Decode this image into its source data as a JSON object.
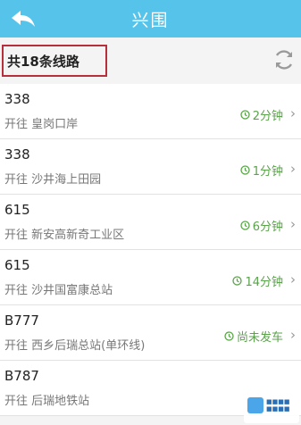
{
  "header": {
    "title": "兴围",
    "back_icon": "back-arrow-icon"
  },
  "summary": {
    "text": "共18条线路",
    "refresh_icon": "refresh-icon"
  },
  "routes": [
    {
      "number": "338",
      "destination": "开往 皇岗口岸",
      "eta": "2分钟"
    },
    {
      "number": "338",
      "destination": "开往 沙井海上田园",
      "eta": "1分钟"
    },
    {
      "number": "615",
      "destination": "开往 新安高新奇工业区",
      "eta": "6分钟"
    },
    {
      "number": "615",
      "destination": "开往 沙井国富康总站",
      "eta": "14分钟"
    },
    {
      "number": "B777",
      "destination": "开往 西乡后瑞总站(单环线)",
      "eta": "尚未发车"
    },
    {
      "number": "B787",
      "destination": "开往 后瑞地铁站",
      "eta": ""
    }
  ],
  "colors": {
    "header_bg": "#56c4ea",
    "eta_green": "#5aa34a",
    "highlight_red": "#b5303a"
  }
}
